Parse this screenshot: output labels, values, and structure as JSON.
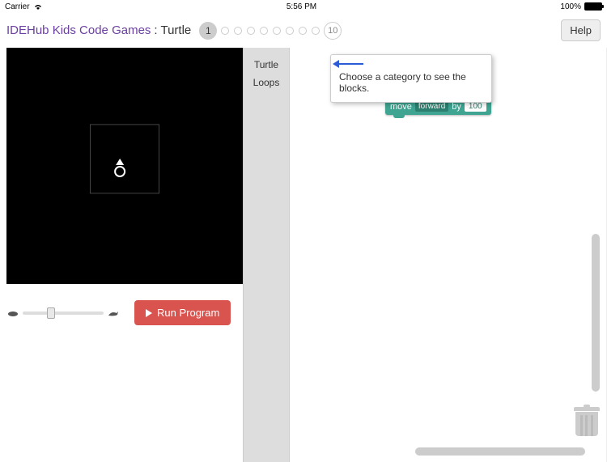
{
  "status": {
    "carrier": "Carrier",
    "time": "5:56 PM",
    "battery": "100%"
  },
  "header": {
    "app_title": "IDEHub Kids Code Games",
    "game_suffix": " : Turtle",
    "level_start": "1",
    "level_end": "10",
    "help_label": "Help"
  },
  "categories": {
    "turtle": "Turtle",
    "loops": "Loops"
  },
  "tooltip": {
    "text": "Choose a category to see the blocks."
  },
  "block": {
    "move": "move",
    "direction": "forward",
    "by": "by",
    "value": "100"
  },
  "controls": {
    "run_label": "Run Program"
  }
}
